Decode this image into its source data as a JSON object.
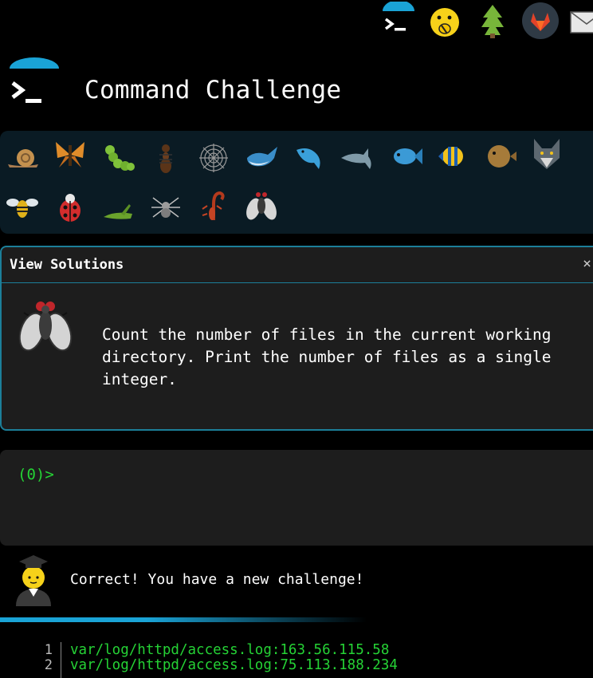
{
  "nav": {
    "icons": [
      "terminal-icon",
      "surprised-face-icon",
      "tree-icon",
      "gitlab-icon",
      "mail-icon"
    ]
  },
  "header": {
    "title": "Command Challenge",
    "logo_icon": "terminal-icon"
  },
  "creatures": [
    "snail-icon",
    "butterfly-icon",
    "caterpillar-icon",
    "ant-icon",
    "spider-web-icon",
    "whale-icon",
    "whale-blue-icon",
    "dolphin-icon",
    "fish-icon",
    "tropical-fish-icon",
    "blowfish-icon",
    "wolf-icon",
    "bee-icon",
    "ladybug-icon",
    "cricket-icon",
    "spider-icon",
    "scorpion-icon",
    "fly-icon"
  ],
  "panel": {
    "title": "View Solutions",
    "close": "×",
    "challenge_icon": "fly-icon",
    "challenge_text": "Count the number of files in the current working directory. Print the number of files as a single integer."
  },
  "terminal": {
    "prompt": "(0)>"
  },
  "feedback": {
    "avatar_icon": "graduate-avatar-icon",
    "message": "Correct! You have a new challenge!"
  },
  "output": {
    "lines": [
      {
        "num": "1",
        "text": "var/log/httpd/access.log:163.56.115.58"
      },
      {
        "num": "2",
        "text": "var/log/httpd/access.log:75.113.188.234"
      }
    ]
  },
  "colors": {
    "accent": "#1c7f99",
    "prompt_green": "#25d235",
    "panel_bg": "#1d1d1d",
    "strip_bg": "#0a1b24"
  }
}
